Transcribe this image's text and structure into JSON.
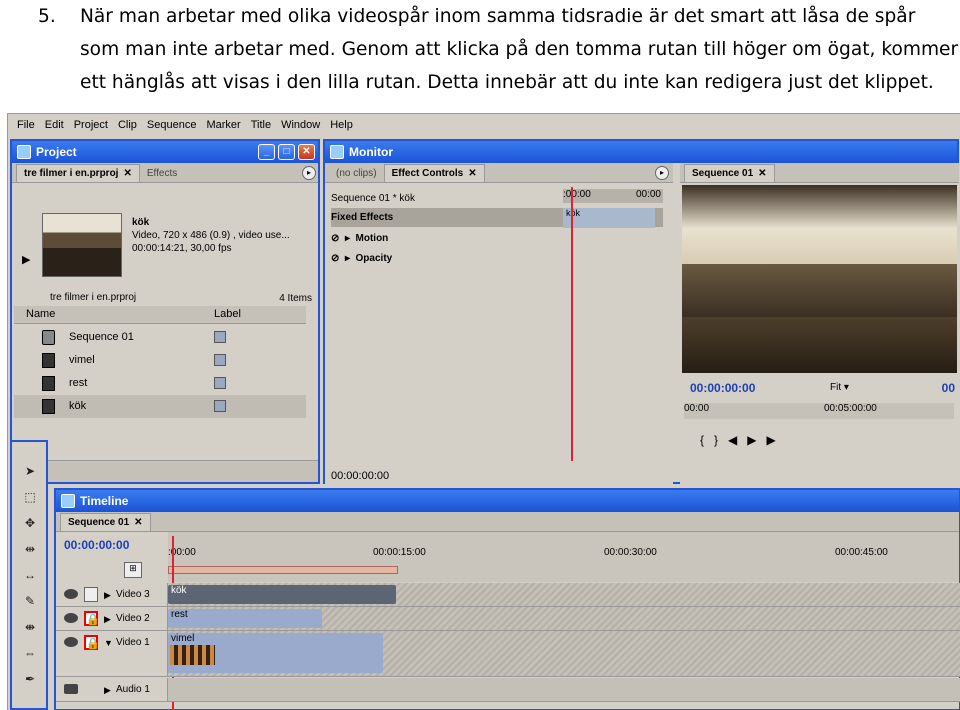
{
  "instruction": {
    "number": "5.",
    "text": "När man arbetar med olika videospår inom samma tidsradie är det smart att låsa de spår som man inte arbetar med. Genom att klicka på den tomma rutan till höger om ögat, kommer ett hänglås att visas i den lilla rutan. Detta innebär att du inte kan redigera just det klippet."
  },
  "menubar": [
    "File",
    "Edit",
    "Project",
    "Clip",
    "Sequence",
    "Marker",
    "Title",
    "Window",
    "Help"
  ],
  "project": {
    "title": "Project",
    "tabs": [
      "tre filmer i en.prproj",
      "Effects"
    ],
    "clip_name": "kök",
    "clip_info": "Video, 720 x 486 (0.9)",
    "clip_info_extra": ", video use...",
    "clip_duration": "00:00:14:21, 30,00 fps",
    "project_file": "tre filmer i en.prproj",
    "item_count": "4 Items",
    "columns": [
      "Name",
      "Label"
    ],
    "items": [
      "Sequence 01",
      "vimel",
      "rest",
      "kök"
    ]
  },
  "monitor": {
    "title": "Monitor",
    "tabs": [
      "(no clips)",
      "Effect Controls"
    ],
    "ec_header": "Sequence 01 * kök",
    "ec_time_start": ":00:00",
    "ec_time_end": "00:00",
    "ec_clip": "kök",
    "fixed_effects": "Fixed Effects",
    "motion": "Motion",
    "opacity": "Opacity",
    "ec_timecode": "00:00:00:00",
    "seq_tab": "Sequence 01",
    "seq_timecode": "00:00:00:00",
    "seq_timecode_right": "00",
    "fit": "Fit",
    "ruler_start": "00:00",
    "ruler_mid": "00:05:00:00"
  },
  "timeline": {
    "title": "Timeline",
    "tab": "Sequence 01",
    "timecode": "00:00:00:00",
    "ruler": [
      ":00:00",
      "00:00:15:00",
      "00:00:30:00",
      "00:00:45:00"
    ],
    "tracks": [
      {
        "name": "Video 3",
        "clip": "kök"
      },
      {
        "name": "Video 2",
        "clip": "rest"
      },
      {
        "name": "Video 1",
        "clip": "vimel"
      },
      {
        "name": "Audio 1",
        "clip": ""
      }
    ]
  }
}
